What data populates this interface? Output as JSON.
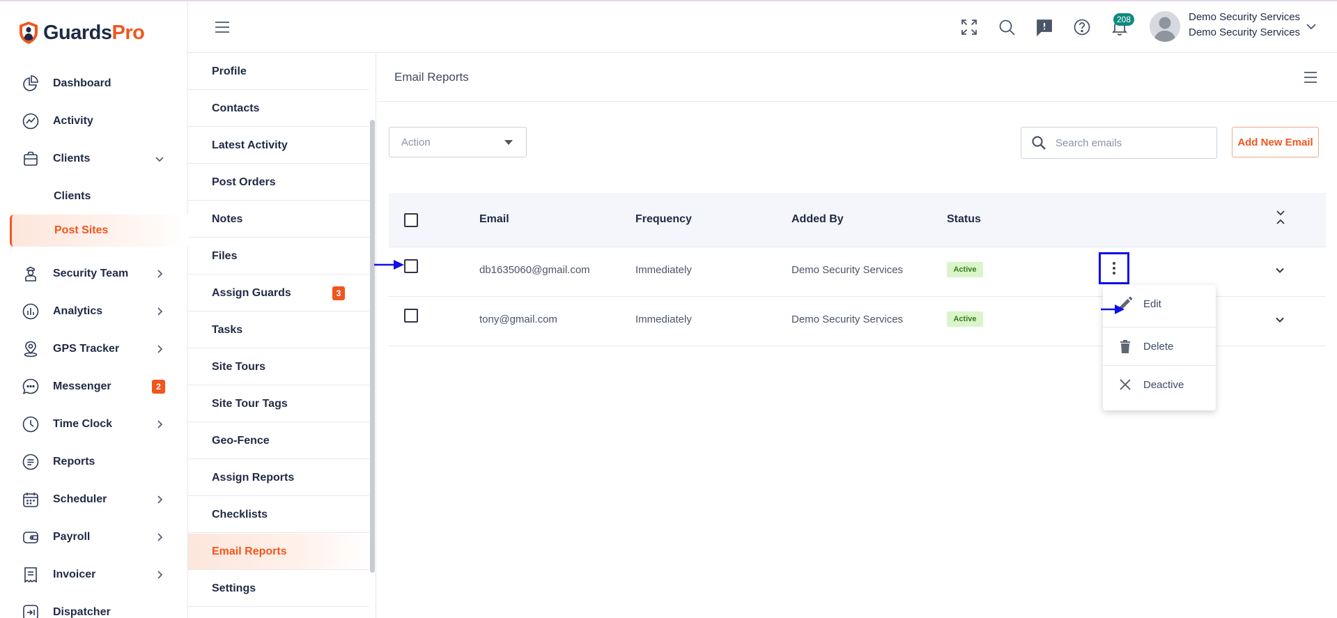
{
  "brand": {
    "name_part1": "Guards",
    "name_part2": "Pro",
    "accent": "#f0561d",
    "dark": "#1f2a44"
  },
  "sidebar": {
    "items": [
      {
        "label": "Dashboard",
        "icon": "pie-chart-icon"
      },
      {
        "label": "Activity",
        "icon": "activity-chart-icon"
      },
      {
        "label": "Clients",
        "icon": "briefcase-icon",
        "expanded": true,
        "children": [
          {
            "label": "Clients"
          },
          {
            "label": "Post Sites",
            "active": true
          }
        ]
      },
      {
        "label": "Security Team",
        "icon": "guard-icon"
      },
      {
        "label": "Analytics",
        "icon": "analytics-icon"
      },
      {
        "label": "GPS Tracker",
        "icon": "location-pin-icon"
      },
      {
        "label": "Messenger",
        "icon": "chat-bubble-icon",
        "badge": "2"
      },
      {
        "label": "Time Clock",
        "icon": "clock-icon"
      },
      {
        "label": "Reports",
        "icon": "report-icon"
      },
      {
        "label": "Scheduler",
        "icon": "calendar-icon"
      },
      {
        "label": "Payroll",
        "icon": "wallet-icon"
      },
      {
        "label": "Invoicer",
        "icon": "invoice-icon"
      },
      {
        "label": "Dispatcher",
        "icon": "dispatch-icon"
      }
    ]
  },
  "header": {
    "notifications_count": "208",
    "user_name": "Demo Security Services",
    "user_company": "Demo Security Services",
    "icons": [
      "fullscreen-icon",
      "search-icon",
      "feedback-icon",
      "help-icon",
      "bell-icon"
    ]
  },
  "subnav": {
    "items": [
      {
        "label": "Profile"
      },
      {
        "label": "Contacts"
      },
      {
        "label": "Latest Activity"
      },
      {
        "label": "Post Orders"
      },
      {
        "label": "Notes"
      },
      {
        "label": "Files"
      },
      {
        "label": "Assign Guards",
        "badge": "3"
      },
      {
        "label": "Tasks"
      },
      {
        "label": "Site Tours"
      },
      {
        "label": "Site Tour Tags"
      },
      {
        "label": "Geo-Fence"
      },
      {
        "label": "Assign Reports"
      },
      {
        "label": "Checklists"
      },
      {
        "label": "Email Reports",
        "active": true
      },
      {
        "label": "Settings"
      }
    ]
  },
  "main": {
    "title": "Email Reports",
    "action_placeholder": "Action",
    "search_placeholder": "Search emails",
    "add_button": "Add New Email",
    "table": {
      "columns": [
        "Email",
        "Frequency",
        "Added By",
        "Status"
      ],
      "rows": [
        {
          "email": "db1635060@gmail.com",
          "frequency": "Immediately",
          "added_by": "Demo Security Services",
          "status": "Active"
        },
        {
          "email": "tony@gmail.com",
          "frequency": "Immediately",
          "added_by": "Demo Security Services",
          "status": "Active"
        }
      ]
    },
    "row_menu": {
      "items": [
        "Edit",
        "Delete",
        "Deactive"
      ]
    }
  }
}
